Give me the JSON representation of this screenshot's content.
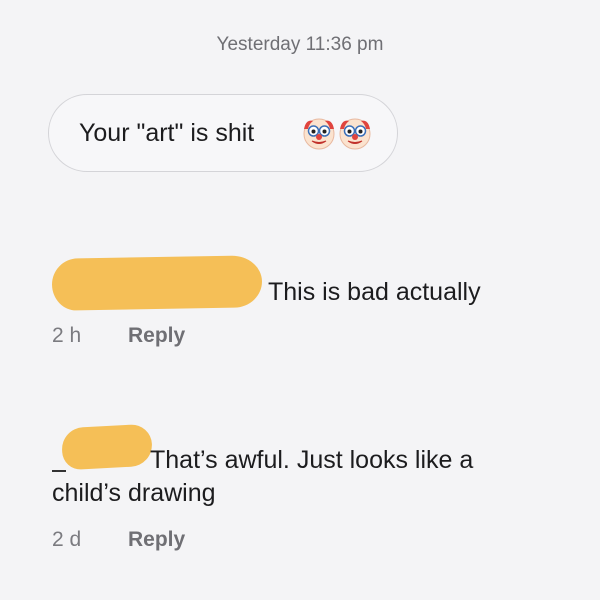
{
  "conversation": {
    "timestamp": "Yesterday 11:36 pm",
    "message": {
      "text": "Your \"art\" is shit",
      "emoji": [
        "clown-face-emoji",
        "clown-face-emoji"
      ]
    }
  },
  "comments": [
    {
      "author_redacted": true,
      "text": "This is bad actually",
      "age": "2 h",
      "reply_label": "Reply"
    },
    {
      "author_redacted": true,
      "text_line1": "That’s awful. Just looks like a",
      "text_line2": "child’s drawing",
      "age": "2 d",
      "reply_label": "Reply"
    }
  ],
  "colors": {
    "background": "#f4f4f6",
    "redaction": "#f5bf57",
    "meta_text": "#7b7b80"
  }
}
